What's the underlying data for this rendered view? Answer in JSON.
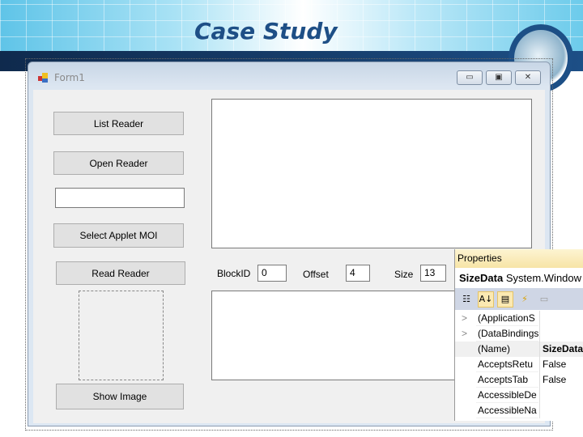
{
  "slide": {
    "title": "Case Study"
  },
  "form": {
    "title": "Form1",
    "min": "▭",
    "max": "▣",
    "close": "✕",
    "buttons": {
      "list_reader": "List Reader",
      "open_reader": "Open Reader",
      "select_applet": "Select Applet MOI",
      "read_reader": "Read Reader",
      "show_image": "Show Image"
    },
    "text_input": "",
    "labels": {
      "block_id": "BlockID",
      "offset": "Offset",
      "size": "Size"
    },
    "values": {
      "block_id": "0",
      "offset": "4",
      "size": "13"
    }
  },
  "properties": {
    "title": "Properties",
    "object_name": "SizeData",
    "object_type": "System.Window",
    "rows": [
      {
        "expand": ">",
        "name": "(ApplicationS",
        "value": ""
      },
      {
        "expand": ">",
        "name": "(DataBindings",
        "value": ""
      },
      {
        "expand": "",
        "name": "(Name)",
        "value": "SizeData"
      },
      {
        "expand": "",
        "name": "AcceptsRetu",
        "value": "False"
      },
      {
        "expand": "",
        "name": "AcceptsTab",
        "value": "False"
      },
      {
        "expand": "",
        "name": "AccessibleDe",
        "value": ""
      },
      {
        "expand": "",
        "name": "AccessibleNa",
        "value": ""
      }
    ]
  }
}
